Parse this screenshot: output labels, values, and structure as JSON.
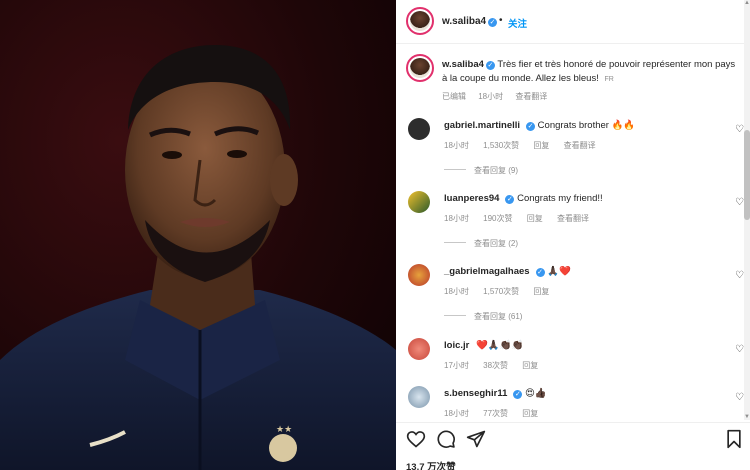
{
  "post": {
    "author": "w.saliba4",
    "follow_label": "关注",
    "dot": "•",
    "caption": "Très fier et très honoré de pouvoir représenter mon pays à la coupe du monde. Allez les bleus!",
    "caption_lang": "FR",
    "caption_meta": {
      "edited": "已编辑",
      "time": "18小时",
      "translate": "查看翻译"
    },
    "likes": "13.7 万次赞"
  },
  "comments": [
    {
      "user": "gabriel.martinelli",
      "verified": true,
      "text": "Congrats brother 🔥🔥",
      "time": "18小时",
      "likes": "1,530次赞",
      "reply": "回复",
      "translate": "查看翻译",
      "view_replies": "查看回复 (9)"
    },
    {
      "user": "luanperes94",
      "verified": true,
      "text": "Congrats my friend!!",
      "time": "18小时",
      "likes": "190次赞",
      "reply": "回复",
      "translate": "查看翻译",
      "view_replies": "查看回复 (2)"
    },
    {
      "user": "_gabrielmagalhaes",
      "verified": true,
      "text": "🙏🏿❤️",
      "time": "18小时",
      "likes": "1,570次赞",
      "reply": "回复",
      "translate": "",
      "view_replies": "查看回复 (61)"
    },
    {
      "user": "loic.jr",
      "verified": false,
      "text": "❤️🙏🏿👏🏿👏🏿",
      "time": "17小时",
      "likes": "38次赞",
      "reply": "回复",
      "translate": "",
      "view_replies": ""
    },
    {
      "user": "s.benseghir11",
      "verified": true,
      "text": "😍👍🏿",
      "time": "18小时",
      "likes": "77次赞",
      "reply": "回复",
      "translate": "",
      "view_replies": ""
    }
  ],
  "icons": {
    "like": "heart-outline-icon",
    "comment": "comment-icon",
    "share": "paper-plane-icon",
    "save": "bookmark-icon"
  },
  "colors": {
    "accent": "#0095f6",
    "verified": "#3897f0",
    "muted": "#8e8e8e",
    "text": "#262626"
  }
}
